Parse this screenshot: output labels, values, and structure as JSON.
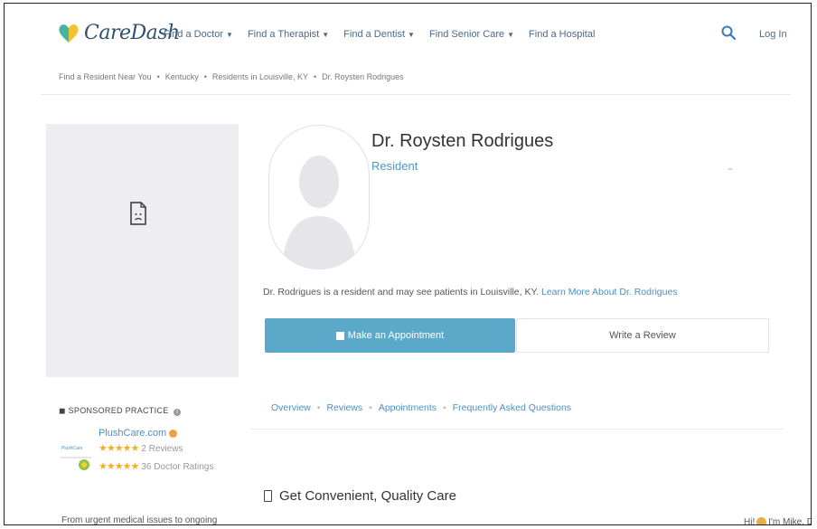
{
  "header": {
    "logo_text": "CareDash",
    "nav": [
      {
        "label": "Find a Doctor",
        "caret": true
      },
      {
        "label": "Find a Therapist",
        "caret": true
      },
      {
        "label": "Find a Dentist",
        "caret": true
      },
      {
        "label": "Find Senior Care",
        "caret": true
      },
      {
        "label": "Find a Hospital",
        "caret": false
      }
    ],
    "login": "Log In"
  },
  "breadcrumb": [
    "Find a Resident Near You",
    "Kentucky",
    "Residents in Louisville, KY",
    "Dr. Roysten Rodrigues"
  ],
  "profile": {
    "name": "Dr. Roysten Rodrigues",
    "role": "Resident",
    "bio_text": "Dr. Rodrigues is a resident and may see patients in Louisville, KY.",
    "bio_link": "Learn More About Dr. Rodrigues",
    "appointment_button": "Make an Appointment",
    "review_button": "Write a Review"
  },
  "tabs": [
    "Overview",
    "Reviews",
    "Appointments",
    "Frequently Asked Questions"
  ],
  "sponsored": {
    "heading": "SPONSORED PRACTICE",
    "practice_name": "PlushCare.com",
    "reviews": "2 Reviews",
    "ratings": "36 Doctor Ratings",
    "description": "From urgent medical issues to ongoing"
  },
  "section_title": "Get Convenient, Quality Care",
  "chat_snippet": {
    "prefix": "Hi!",
    "text": "I'm Mike. Do you"
  },
  "colors": {
    "brand": "#2f4f6f",
    "accent": "#5aa9c8",
    "link": "#4a90c2",
    "star": "#f0b020"
  }
}
